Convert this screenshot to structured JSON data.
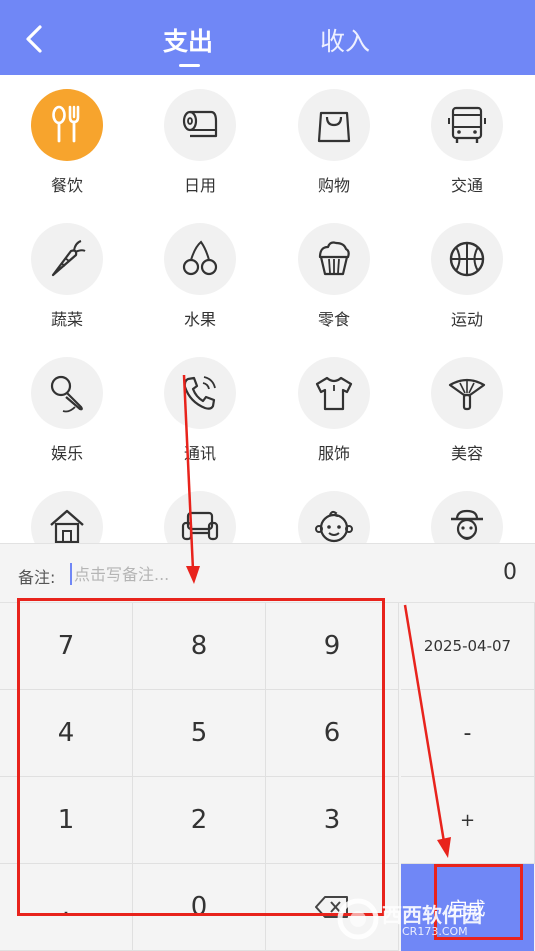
{
  "header": {
    "tabs": [
      {
        "label": "支出",
        "active": true
      },
      {
        "label": "收入",
        "active": false
      }
    ]
  },
  "categories": [
    {
      "label": "餐饮",
      "icon": "utensils-icon",
      "selected": true
    },
    {
      "label": "日用",
      "icon": "tissue-roll-icon"
    },
    {
      "label": "购物",
      "icon": "shopping-bag-icon"
    },
    {
      "label": "交通",
      "icon": "bus-icon"
    },
    {
      "label": "蔬菜",
      "icon": "carrot-icon"
    },
    {
      "label": "水果",
      "icon": "cherries-icon"
    },
    {
      "label": "零食",
      "icon": "cupcake-icon"
    },
    {
      "label": "运动",
      "icon": "basketball-icon"
    },
    {
      "label": "娱乐",
      "icon": "microphone-icon"
    },
    {
      "label": "通讯",
      "icon": "phone-icon"
    },
    {
      "label": "服饰",
      "icon": "tshirt-icon"
    },
    {
      "label": "美容",
      "icon": "fan-icon"
    },
    {
      "label": "",
      "icon": "house-icon"
    },
    {
      "label": "",
      "icon": "sofa-icon"
    },
    {
      "label": "",
      "icon": "baby-icon"
    },
    {
      "label": "",
      "icon": "elder-icon"
    }
  ],
  "remark": {
    "label": "备注:",
    "placeholder": "点击写备注...",
    "amount": "0"
  },
  "keypad": {
    "digits": [
      "7",
      "8",
      "9",
      "4",
      "5",
      "6",
      "1",
      "2",
      "3",
      ".",
      "0"
    ],
    "date": "2025-04-07",
    "minus": "-",
    "plus": "+",
    "done": "完成"
  },
  "watermark": {
    "brand": "西西软件园",
    "url": "CR173.COM"
  },
  "colors": {
    "primary": "#7087f6",
    "selected": "#f7a42d",
    "annotation": "#e8231c"
  }
}
